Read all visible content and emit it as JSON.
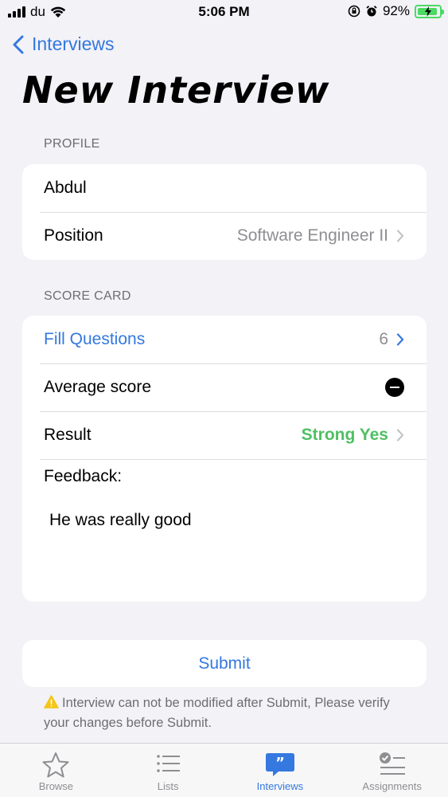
{
  "status_bar": {
    "carrier": "du",
    "time": "5:06 PM",
    "battery_percent": "92%",
    "battery_level": 0.92
  },
  "nav": {
    "back_label": "Interviews",
    "title": "New Interview"
  },
  "profile": {
    "header": "PROFILE",
    "name": "Abdul",
    "position_label": "Position",
    "position_value": "Software Engineer II"
  },
  "score_card": {
    "header": "SCORE CARD",
    "fill_questions_label": "Fill Questions",
    "fill_questions_count": "6",
    "average_score_label": "Average score",
    "result_label": "Result",
    "result_value": "Strong Yes",
    "feedback_label": "Feedback:",
    "feedback_text": "He was really good"
  },
  "submit_label": "Submit",
  "warning_text": "Interview can not be modified after Submit, Please verify your changes before Submit.",
  "tabs": [
    {
      "label": "Browse",
      "icon": "star-icon",
      "active": false
    },
    {
      "label": "Lists",
      "icon": "list-icon",
      "active": false
    },
    {
      "label": "Interviews",
      "icon": "quote-bubble-icon",
      "active": true
    },
    {
      "label": "Assignments",
      "icon": "checklist-icon",
      "active": false
    }
  ],
  "colors": {
    "accent": "#3478e0",
    "success": "#4fbf63",
    "background": "#f2f2f7"
  }
}
